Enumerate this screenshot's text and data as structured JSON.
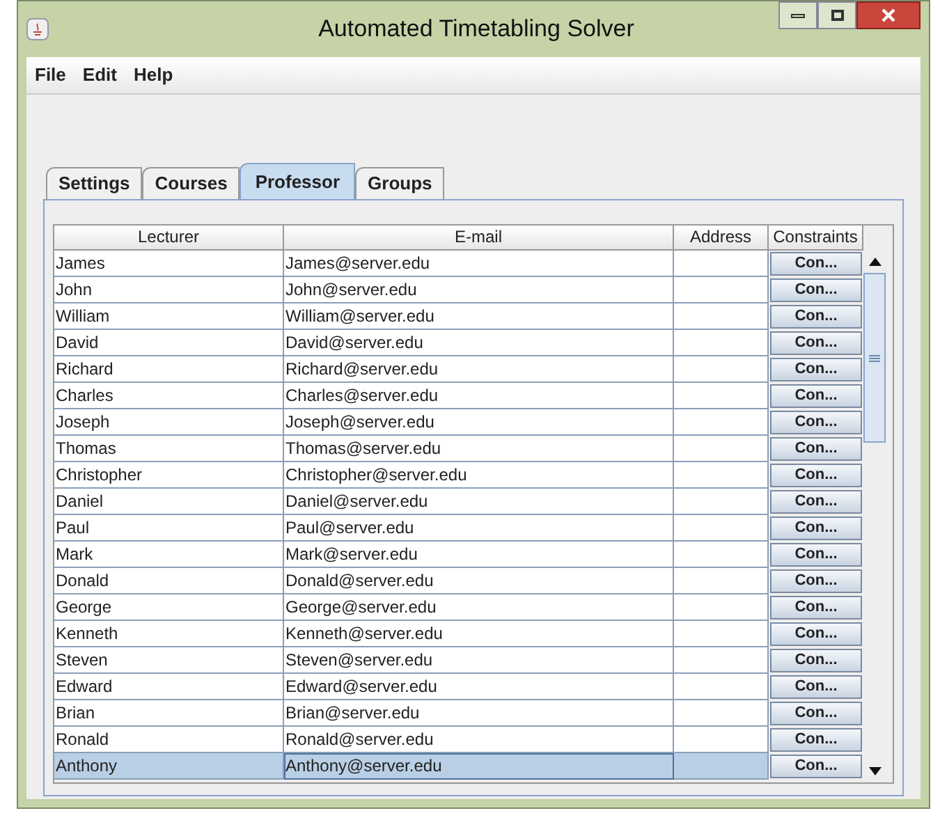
{
  "window": {
    "title": "Automated Timetabling Solver"
  },
  "menu": [
    "File",
    "Edit",
    "Help"
  ],
  "tabs": [
    {
      "label": "Settings",
      "selected": false
    },
    {
      "label": "Courses",
      "selected": false
    },
    {
      "label": "Professor",
      "selected": true
    },
    {
      "label": "Groups",
      "selected": false
    }
  ],
  "table": {
    "columns": [
      "Lecturer",
      "E-mail",
      "Address",
      "Constraints"
    ],
    "rows": [
      {
        "lecturer": "James",
        "email": "James@server.edu",
        "action": "Con...",
        "selected": false
      },
      {
        "lecturer": "John",
        "email": "John@server.edu",
        "action": "Con...",
        "selected": false
      },
      {
        "lecturer": "William",
        "email": "William@server.edu",
        "action": "Con...",
        "selected": false
      },
      {
        "lecturer": "David",
        "email": "David@server.edu",
        "action": "Con...",
        "selected": false
      },
      {
        "lecturer": "Richard",
        "email": "Richard@server.edu",
        "action": "Con...",
        "selected": false
      },
      {
        "lecturer": "Charles",
        "email": "Charles@server.edu",
        "action": "Con...",
        "selected": false
      },
      {
        "lecturer": "Joseph",
        "email": "Joseph@server.edu",
        "action": "Con...",
        "selected": false
      },
      {
        "lecturer": "Thomas",
        "email": "Thomas@server.edu",
        "action": "Con...",
        "selected": false
      },
      {
        "lecturer": "Christopher",
        "email": "Christopher@server.edu",
        "action": "Con...",
        "selected": false
      },
      {
        "lecturer": "Daniel",
        "email": "Daniel@server.edu",
        "action": "Con...",
        "selected": false
      },
      {
        "lecturer": "Paul",
        "email": "Paul@server.edu",
        "action": "Con...",
        "selected": false
      },
      {
        "lecturer": "Mark",
        "email": "Mark@server.edu",
        "action": "Con...",
        "selected": false
      },
      {
        "lecturer": "Donald",
        "email": "Donald@server.edu",
        "action": "Con...",
        "selected": false
      },
      {
        "lecturer": "George",
        "email": "George@server.edu",
        "action": "Con...",
        "selected": false
      },
      {
        "lecturer": "Kenneth",
        "email": "Kenneth@server.edu",
        "action": "Con...",
        "selected": false
      },
      {
        "lecturer": "Steven",
        "email": "Steven@server.edu",
        "action": "Con...",
        "selected": false
      },
      {
        "lecturer": "Edward",
        "email": "Edward@server.edu",
        "action": "Con...",
        "selected": false
      },
      {
        "lecturer": "Brian",
        "email": "Brian@server.edu",
        "action": "Con...",
        "selected": false
      },
      {
        "lecturer": "Ronald",
        "email": "Ronald@server.edu",
        "action": "Con...",
        "selected": false
      },
      {
        "lecturer": "Anthony",
        "email": "Anthony@server.edu",
        "action": "Con...",
        "selected": true
      }
    ]
  }
}
